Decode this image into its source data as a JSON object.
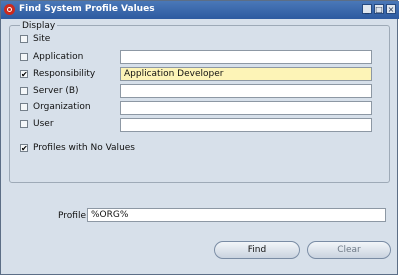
{
  "window": {
    "title": "Find System Profile Values",
    "minimize_glyph": "_",
    "maximize_glyph": "□",
    "close_glyph": "×"
  },
  "display": {
    "legend": "Display",
    "options": [
      {
        "label": "Site",
        "checked": false,
        "value": ""
      },
      {
        "label": "Application",
        "checked": false,
        "value": ""
      },
      {
        "label": "Responsibility",
        "checked": true,
        "value": "Application Developer"
      },
      {
        "label": "Server (B)",
        "checked": false,
        "value": ""
      },
      {
        "label": "Organization",
        "checked": false,
        "value": ""
      },
      {
        "label": "User",
        "checked": false,
        "value": ""
      }
    ],
    "profiles_no_values": {
      "label": "Profiles with No Values",
      "checked": true
    }
  },
  "profile": {
    "label": "Profile",
    "value": "%ORG%"
  },
  "buttons": {
    "find": "Find",
    "clear": "Clear"
  },
  "colors": {
    "title_bar": "#2d5aa0",
    "window_bg": "#d7e0ea",
    "highlight_field": "#fdf4b7",
    "app_icon": "#cc2a1c"
  },
  "icons": {
    "app": "oracle-icon",
    "minimize": "minimize-icon",
    "maximize": "maximize-icon",
    "close": "close-icon",
    "check": "checkmark-icon"
  }
}
